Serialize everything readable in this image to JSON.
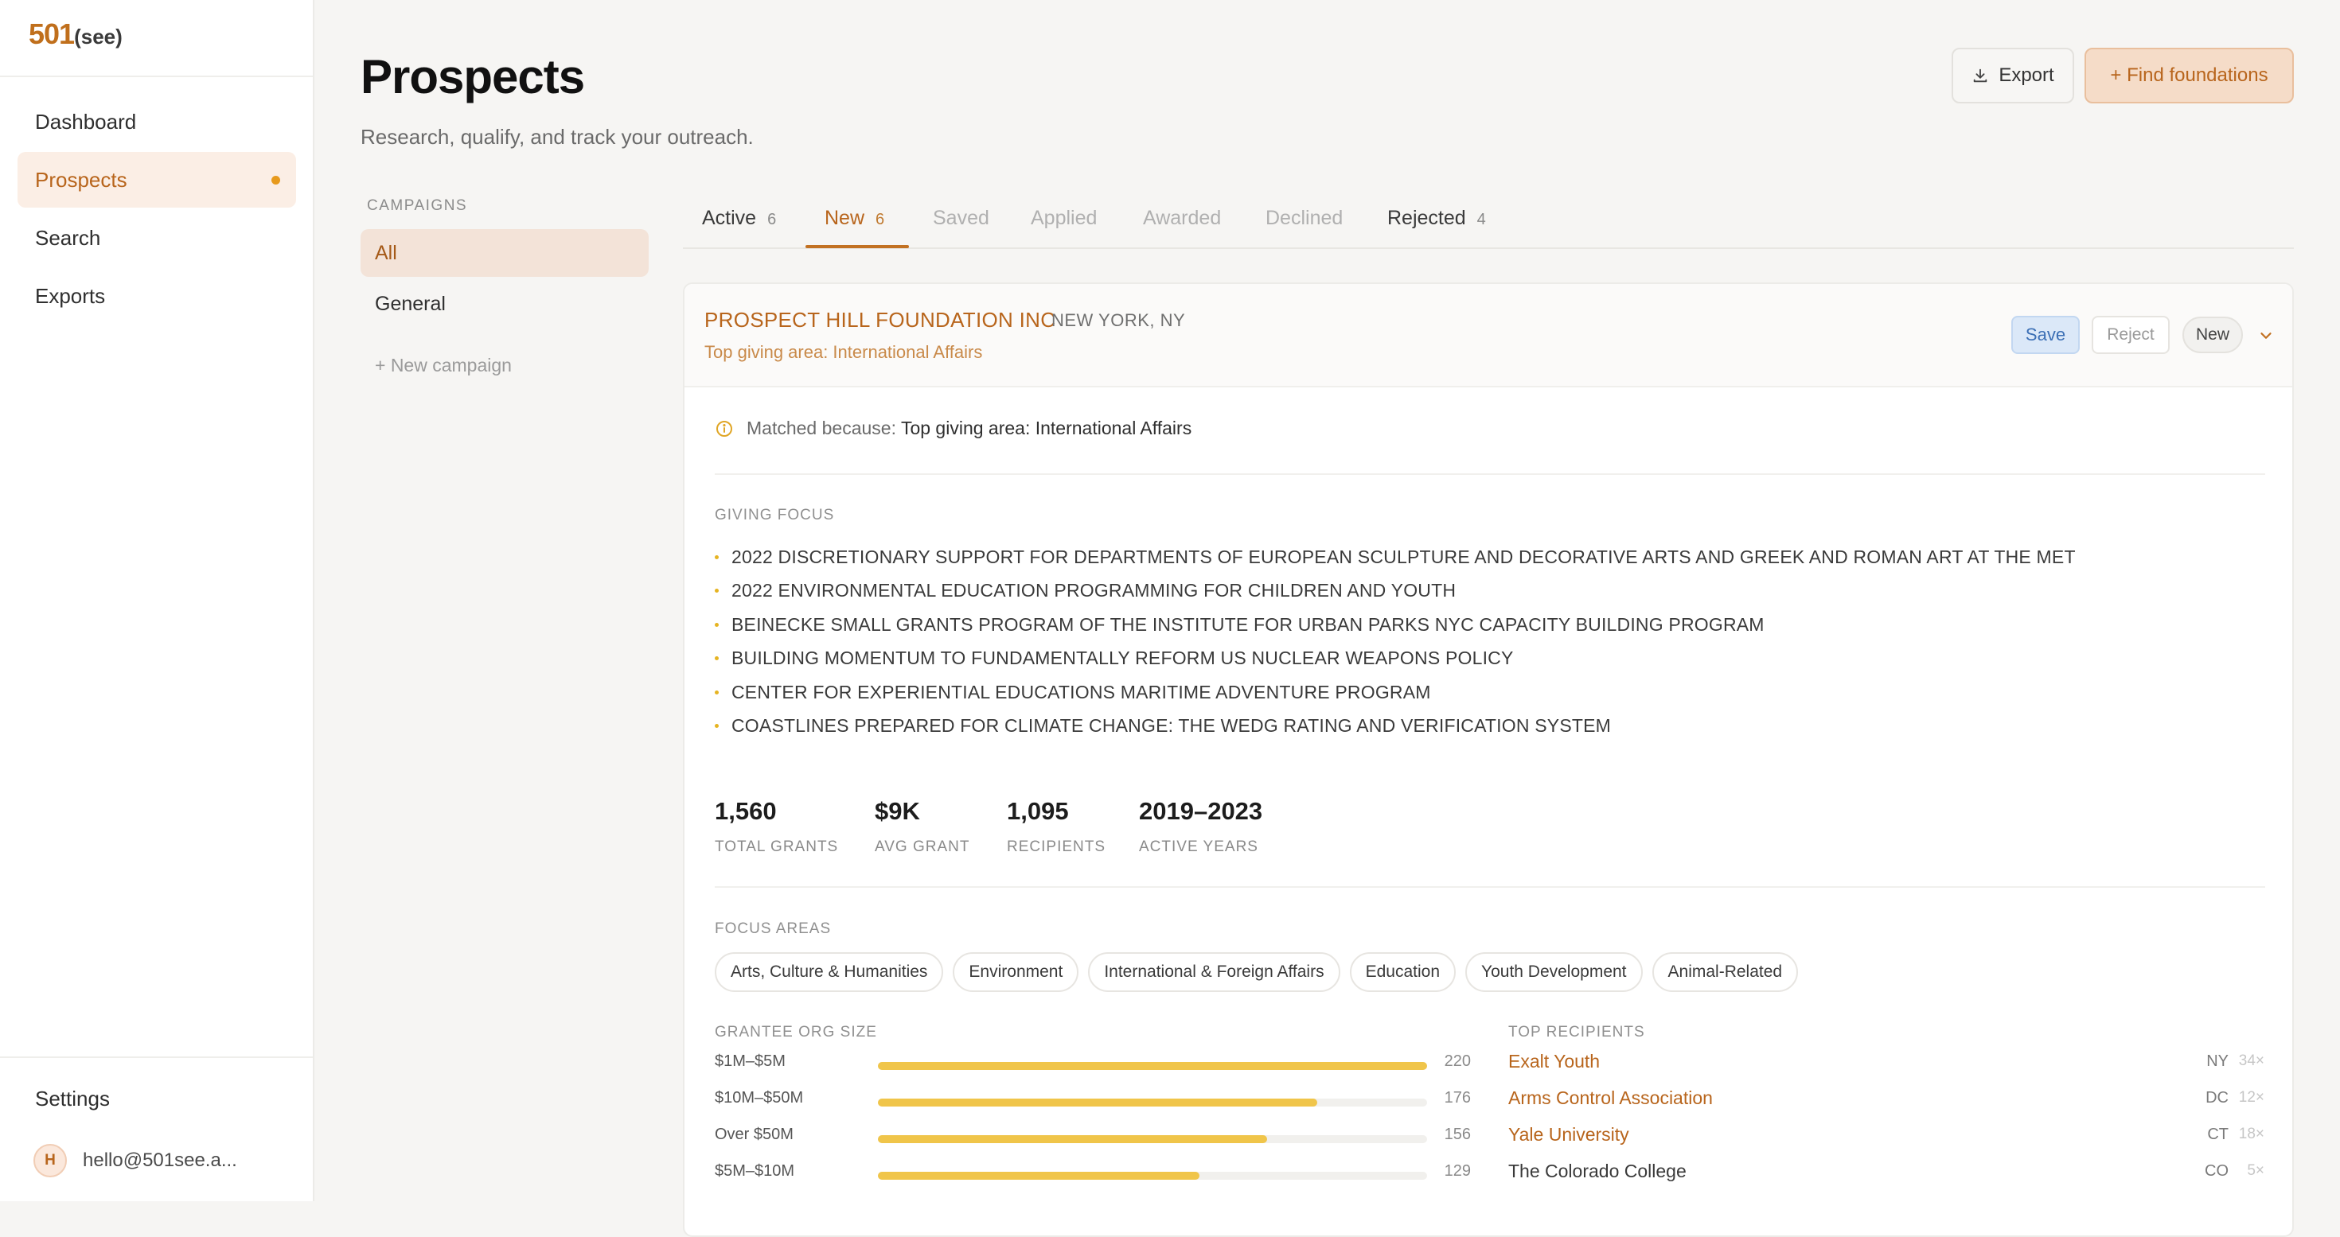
{
  "app": {
    "logo_main": "501",
    "logo_suffix": "(see)"
  },
  "sidebar": {
    "items": [
      {
        "label": "Dashboard",
        "active": false
      },
      {
        "label": "Prospects",
        "active": true
      },
      {
        "label": "Search",
        "active": false
      },
      {
        "label": "Exports",
        "active": false
      }
    ],
    "settings_label": "Settings",
    "user_initial": "H",
    "user_email": "hello@501see.a..."
  },
  "header": {
    "title": "Prospects",
    "subtitle": "Research, qualify, and track your outreach.",
    "export_label": "Export",
    "find_label": "+ Find foundations"
  },
  "campaigns": {
    "heading": "CAMPAIGNS",
    "items": [
      {
        "label": "All",
        "active": true
      },
      {
        "label": "General",
        "active": false
      }
    ],
    "new_label": "+ New campaign"
  },
  "tabs": [
    {
      "label": "Active",
      "count": "6"
    },
    {
      "label": "New",
      "count": "6",
      "active": true
    },
    {
      "label": "Saved",
      "count": ""
    },
    {
      "label": "Applied",
      "count": ""
    },
    {
      "label": "Awarded",
      "count": ""
    },
    {
      "label": "Declined",
      "count": ""
    },
    {
      "label": "Rejected",
      "count": "4"
    }
  ],
  "prospect": {
    "name": "PROSPECT HILL FOUNDATION INC",
    "location": "NEW YORK, NY",
    "subline": "Top giving area: International Affairs",
    "save_label": "Save",
    "reject_label": "Reject",
    "status_label": "New",
    "match_label": "Matched because:",
    "match_value": "Top giving area: International Affairs",
    "giving_focus_heading": "GIVING FOCUS",
    "giving_focus": [
      "2022 DISCRETIONARY SUPPORT FOR DEPARTMENTS OF EUROPEAN SCULPTURE AND DECORATIVE ARTS AND GREEK AND ROMAN ART AT THE MET",
      "2022 ENVIRONMENTAL EDUCATION PROGRAMMING FOR CHILDREN AND YOUTH",
      "BEINECKE SMALL GRANTS PROGRAM OF THE INSTITUTE FOR URBAN PARKS NYC CAPACITY BUILDING PROGRAM",
      "BUILDING MOMENTUM TO FUNDAMENTALLY REFORM US NUCLEAR WEAPONS POLICY",
      "CENTER FOR EXPERIENTIAL EDUCATIONS MARITIME ADVENTURE PROGRAM",
      "COASTLINES PREPARED FOR CLIMATE CHANGE: THE WEDG RATING AND VERIFICATION SYSTEM"
    ],
    "stats": [
      {
        "value": "1,560",
        "label": "TOTAL GRANTS"
      },
      {
        "value": "$9K",
        "label": "AVG GRANT"
      },
      {
        "value": "1,095",
        "label": "RECIPIENTS"
      },
      {
        "value": "2019–2023",
        "label": "ACTIVE YEARS"
      }
    ],
    "focus_areas_heading": "FOCUS AREAS",
    "focus_areas": [
      "Arts, Culture & Humanities",
      "Environment",
      "International & Foreign Affairs",
      "Education",
      "Youth Development",
      "Animal-Related"
    ],
    "grantee_size_heading": "GRANTEE ORG SIZE",
    "grantee_sizes": [
      {
        "label": "$1M–$5M",
        "count": "220",
        "fraction": 1.0
      },
      {
        "label": "$10M–$50M",
        "count": "176",
        "fraction": 0.8
      },
      {
        "label": "Over $50M",
        "count": "156",
        "fraction": 0.709
      },
      {
        "label": "$5M–$10M",
        "count": "129",
        "fraction": 0.586
      }
    ],
    "top_recipients_heading": "TOP RECIPIENTS",
    "top_recipients": [
      {
        "name": "Exalt Youth",
        "state": "NY",
        "times": "34×",
        "link": true
      },
      {
        "name": "Arms Control Association",
        "state": "DC",
        "times": "12×",
        "link": true
      },
      {
        "name": "Yale University",
        "state": "CT",
        "times": "18×",
        "link": true
      },
      {
        "name": "The Colorado College",
        "state": "CO",
        "times": "5×",
        "link": false
      }
    ]
  },
  "colors": {
    "accent": "#b8651c",
    "accent_bg": "#fbeee5",
    "bar": "#f0c54a",
    "save_blue": "#3b6fb5"
  }
}
